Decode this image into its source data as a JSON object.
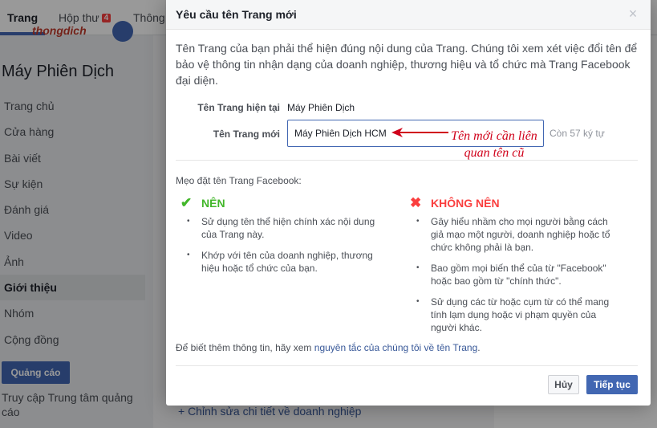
{
  "background": {
    "tabs": [
      {
        "label": "Trang"
      },
      {
        "label": "Hộp thư",
        "badge": "4"
      },
      {
        "label": "Thông"
      }
    ],
    "logo_text": "thongdich",
    "page_name": "Máy Phiên Dịch",
    "nav_items": [
      "Trang chủ",
      "Cửa hàng",
      "Bài viết",
      "Sự kiện",
      "Đánh giá",
      "Video",
      "Ảnh",
      "Giới thiệu",
      "Nhóm",
      "Cộng đồng"
    ],
    "selected_nav": "Giới thiệu",
    "promote_button": "Quảng cáo",
    "ads_center_link": "Truy cập Trung tâm quảng cáo",
    "edit_details_link": "+ Chỉnh sửa chi tiết về doanh nghiệp"
  },
  "dialog": {
    "title": "Yêu cầu tên Trang mới",
    "close_symbol": "×",
    "intro": "Tên Trang của bạn phải thể hiện đúng nội dung của Trang. Chúng tôi xem xét việc đổi tên để bảo vệ thông tin nhận dạng của doanh nghiệp, thương hiệu và tổ chức mà Trang Facebook đại diện.",
    "current_name_label": "Tên Trang hiện tại",
    "current_name_value": "Máy Phiên Dịch",
    "new_name_label": "Tên Trang mới",
    "new_name_value": "Máy Phiên Dịch HCM",
    "char_count": "Còn 57 ký tự",
    "annotation": "Tên mới cần liên quan tên cũ",
    "tips_label": "Mẹo đặt tên Trang Facebook:",
    "do_heading": "NÊN",
    "do_items": [
      "Sử dụng tên thể hiện chính xác nội dung của Trang này.",
      "Khớp với tên của doanh nghiệp, thương hiệu hoặc tổ chức của bạn."
    ],
    "dont_heading": "KHÔNG NÊN",
    "dont_items": [
      "Gây hiểu nhầm cho mọi người bằng cách giả mạo một người, doanh nghiệp hoặc tổ chức không phải là bạn.",
      "Bao gồm mọi biến thể của từ \"Facebook\" hoặc bao gồm từ \"chính thức\".",
      "Sử dụng các từ hoặc cụm từ có thể mang tính lạm dụng hoặc vi phạm quyền của người khác."
    ],
    "more_info_prefix": "Để biết thêm thông tin, hãy xem ",
    "more_info_link": "nguyên tắc của chúng tôi về tên Trang",
    "more_info_suffix": ".",
    "cancel_label": "Hủy",
    "continue_label": "Tiếp tục"
  },
  "colors": {
    "brand_blue": "#4267b2",
    "do_green": "#42b72a",
    "dont_red": "#fa3e3e",
    "annotation_red": "#d0021b"
  }
}
